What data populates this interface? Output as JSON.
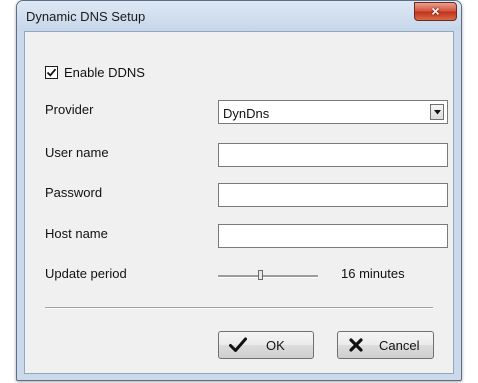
{
  "window": {
    "title": "Dynamic DNS Setup",
    "close_glyph": "×"
  },
  "enable_ddns": {
    "label": "Enable DDNS",
    "checked": true
  },
  "fields": {
    "provider": {
      "label": "Provider",
      "value": "DynDns"
    },
    "user_name": {
      "label": "User name",
      "value": ""
    },
    "password": {
      "label": "Password",
      "value": ""
    },
    "host_name": {
      "label": "Host name",
      "value": ""
    }
  },
  "update_period": {
    "label": "Update period",
    "value_text": "16  minutes",
    "slider_fraction": 0.42
  },
  "buttons": {
    "ok": {
      "label": "OK",
      "icon": "checkmark-icon"
    },
    "cancel": {
      "label": "Cancel",
      "icon": "x-icon"
    }
  },
  "colors": {
    "close_button": "#c83a22",
    "window_frame": "#cbd9ea",
    "client_bg": "#f0f0f0"
  }
}
